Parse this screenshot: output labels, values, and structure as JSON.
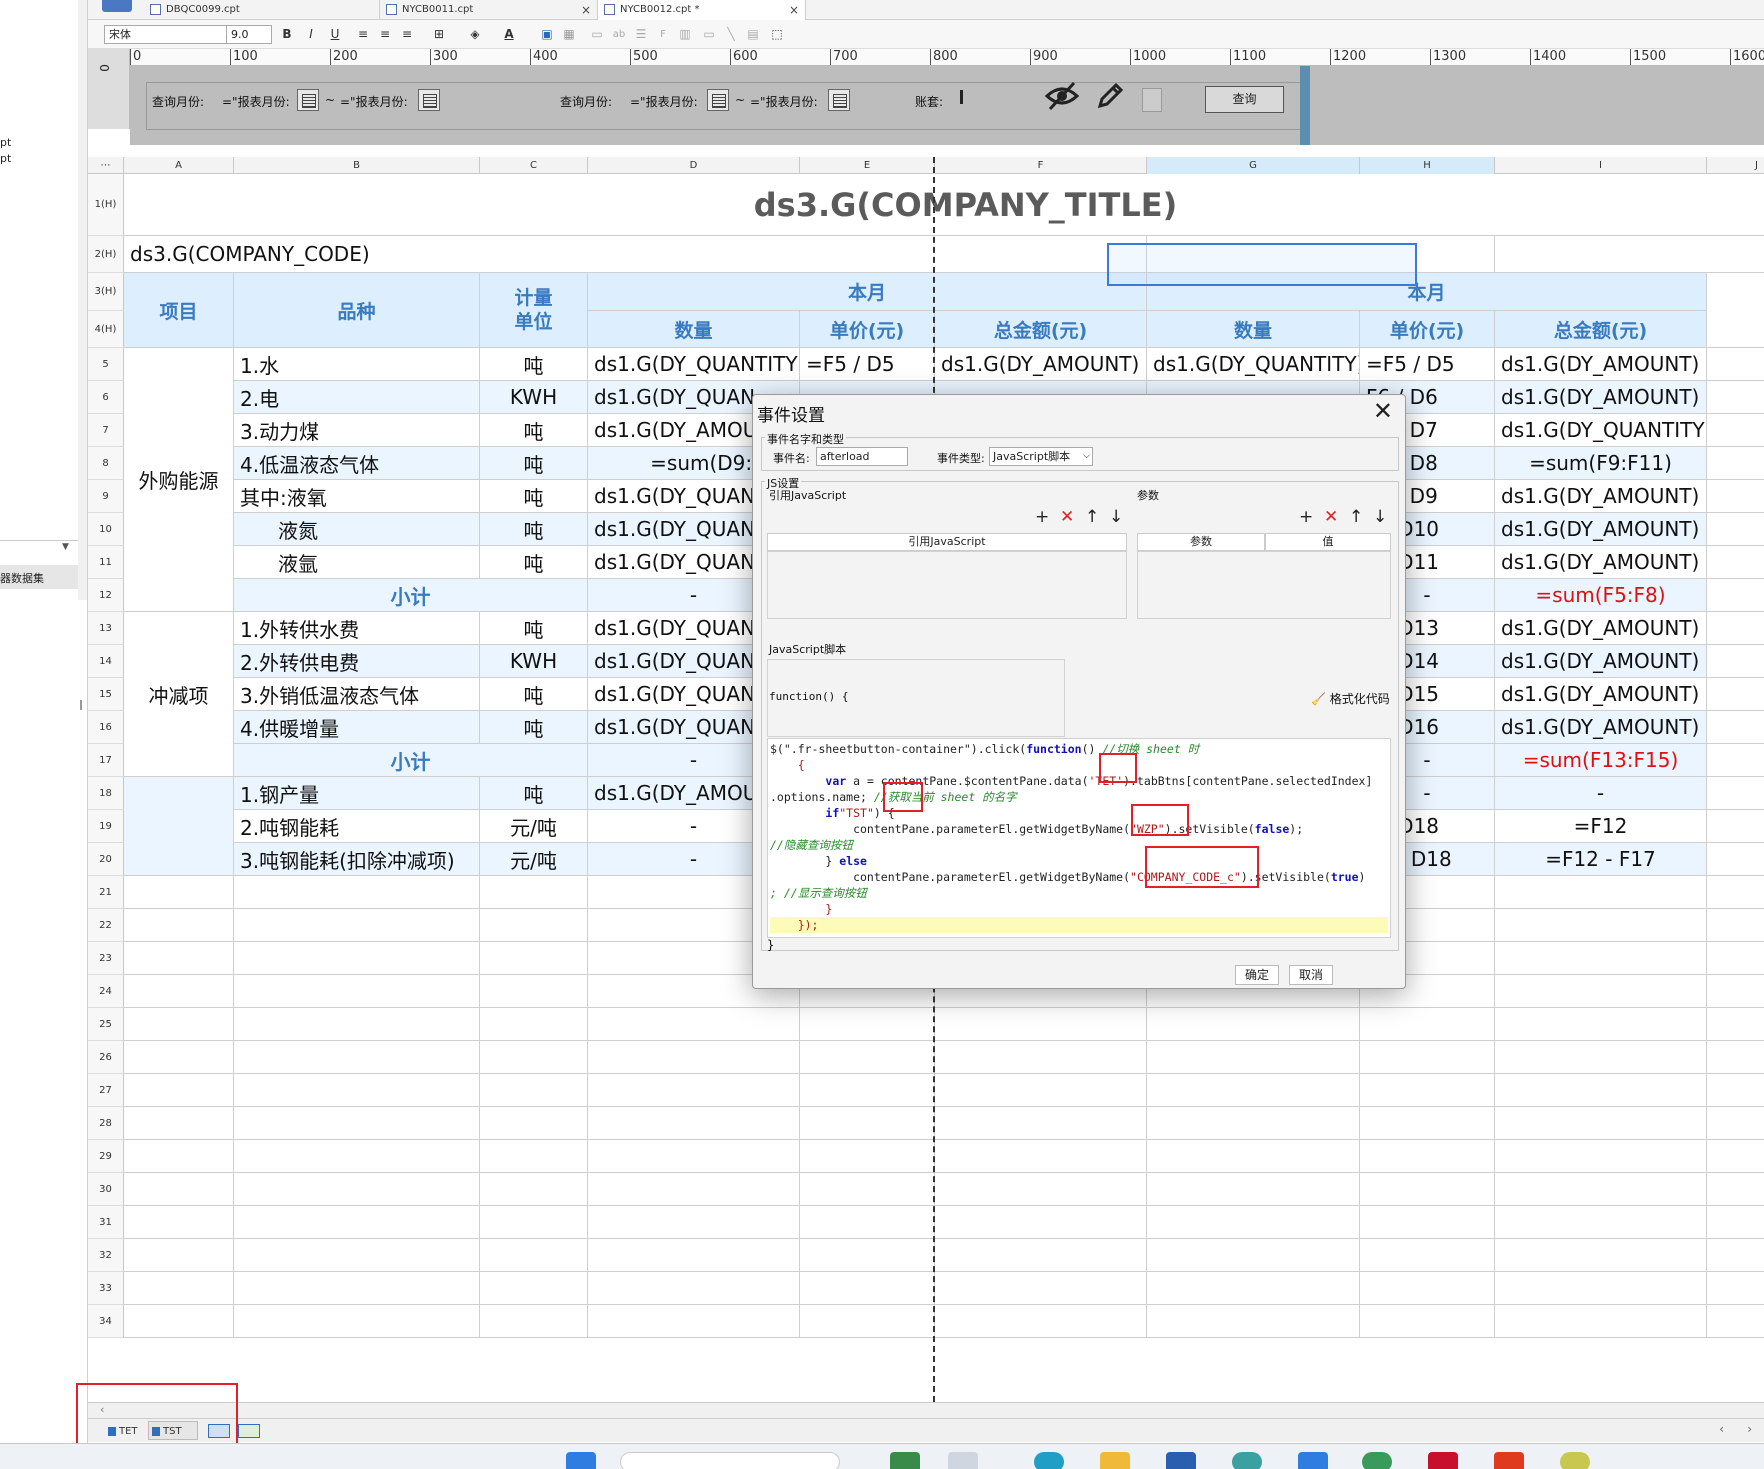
{
  "tabs": [
    {
      "label": "DBQC0099.cpt"
    },
    {
      "label": "NYCB0011.cpt"
    },
    {
      "label": "NYCB0012.cpt *"
    }
  ],
  "toolbar": {
    "font": "宋体",
    "size": "9.0",
    "bold": "B",
    "italic": "I",
    "underline": "U"
  },
  "left_panel": {
    "items": [
      "pt",
      "pt"
    ],
    "dataset_label": "器数据集"
  },
  "ruler": {
    "ticks": [
      "0",
      "100",
      "200",
      "300",
      "400",
      "500",
      "600",
      "700",
      "800",
      "900",
      "1000",
      "1100",
      "1200",
      "1300",
      "1400",
      "1500",
      "1600"
    ],
    "side": "0"
  },
  "params": {
    "label1": "查询月份:",
    "label2": "=\"报表月份:",
    "tilde": "~",
    "label3": "=\"报表月份:",
    "label4": "查询月份:",
    "label5": "=\"报表月份:",
    "tilde2": "~",
    "label6": "=\"报表月份:",
    "label7": "账套:",
    "query_button": "查询"
  },
  "columns": [
    "A",
    "B",
    "C",
    "D",
    "E",
    "F",
    "G",
    "H",
    "I",
    "J"
  ],
  "rows": {
    "labels": [
      "1(H)",
      "2(H)",
      "3(H)",
      "4(H)",
      "5",
      "6",
      "7",
      "8",
      "9",
      "10",
      "11",
      "12",
      "13",
      "14",
      "15",
      "16",
      "17",
      "18",
      "19",
      "20",
      "21",
      "22",
      "23",
      "24",
      "25",
      "26",
      "27",
      "28",
      "29",
      "30",
      "31",
      "32",
      "33",
      "34"
    ]
  },
  "report": {
    "title": "ds3.G(COMPANY_TITLE)",
    "company_code": "ds3.G(COMPANY_CODE)",
    "headers": {
      "item": "项目",
      "variety": "品种",
      "unit": "计量\n单位",
      "month": "本月",
      "month2": "本月",
      "qty": "数量",
      "price": "单价(元)",
      "total": "总金额(元)",
      "qty2": "数量",
      "price2": "单价(元)",
      "total2": "总金额(元)"
    },
    "groups": [
      "外购能源",
      "冲减项"
    ],
    "subtotal": "小计",
    "body": [
      {
        "b": "1.水",
        "c": "吨",
        "d": "ds1.G(DY_QUANTITY)",
        "e": "=F5 / D5",
        "f": "ds1.G(DY_AMOUNT)",
        "g": "ds1.G(DY_QUANTITY)",
        "h": "=F5 / D5",
        "i": "ds1.G(DY_AMOUNT)"
      },
      {
        "b": "2.电",
        "c": "KWH",
        "d": "ds1.G(DY_QUAN",
        "h": "F6 / D6",
        "i": "ds1.G(DY_AMOUNT)"
      },
      {
        "b": "3.动力煤",
        "c": "吨",
        "d": "ds1.G(DY_AMOU",
        "h": "F7 / D7",
        "i": "ds1.G(DY_QUANTITY)"
      },
      {
        "b": "4.低温液态气体",
        "c": "吨",
        "d": "=sum(D9:D11",
        "h": "F8 / D8",
        "i": "=sum(F9:F11)"
      },
      {
        "b": "其中:液氧",
        "c": "吨",
        "d": "ds1.G(DY_QUAN",
        "h": "F9 / D9",
        "i": "ds1.G(DY_AMOUNT)"
      },
      {
        "b": "液氮",
        "c": "吨",
        "d": "ds1.G(DY_QUAN",
        "h": "0 / D10",
        "i": "ds1.G(DY_AMOUNT)"
      },
      {
        "b": "液氩",
        "c": "吨",
        "d": "ds1.G(DY_QUAN",
        "h": "1 / D11",
        "i": "ds1.G(DY_AMOUNT)"
      },
      {
        "b": "",
        "c": "",
        "d": "-",
        "h": "-",
        "i": "=sum(F5:F8)"
      },
      {
        "b": "1.外转供水费",
        "c": "吨",
        "d": "ds1.G(DY_QUAN",
        "h": "3 / D13",
        "i": "ds1.G(DY_AMOUNT)"
      },
      {
        "b": "2.外转供电费",
        "c": "KWH",
        "d": "ds1.G(DY_QUAN",
        "h": "4 / D14",
        "i": "ds1.G(DY_AMOUNT)"
      },
      {
        "b": "3.外销低温液态气体",
        "c": "吨",
        "d": "ds1.G(DY_QUAN",
        "h": "5 / D15",
        "i": "ds1.G(DY_AMOUNT)"
      },
      {
        "b": "4.供暖增量",
        "c": "吨",
        "d": "ds1.G(DY_QUAN",
        "h": "6 / D16",
        "i": "ds1.G(DY_AMOUNT)"
      },
      {
        "b": "",
        "c": "",
        "d": "-",
        "h": "-",
        "i": "=sum(F13:F15)"
      },
      {
        "b": "1.钢产量",
        "c": "吨",
        "d": "ds1.G(DY_AMOU",
        "h": "-",
        "i": "-"
      },
      {
        "b": "2.吨钢能耗",
        "c": "元/吨",
        "d": "-",
        "h": "9 / D18",
        "i": "=F12"
      },
      {
        "b": "3.吨钢能耗(扣除冲减项)",
        "c": "元/吨",
        "d": "-",
        "h": "20 / D18",
        "i": "=F12 - F17"
      }
    ]
  },
  "dialog": {
    "title": "事件设置",
    "group1": "事件名字和类型",
    "event_name_label": "事件名:",
    "event_name_value": "afterload",
    "event_type_label": "事件类型:",
    "event_type_value": "JavaScript脚本",
    "js_group": "JS设置",
    "ref_js": "引用JavaScript",
    "params": "参数",
    "ref_js_col": "引用JavaScript",
    "param_col": "参数",
    "value_col": "值",
    "script_label": "JavaScript脚本",
    "func_header": "function() {",
    "format_code": "格式化代码",
    "closing": "}",
    "ok": "确定",
    "cancel": "取消"
  },
  "code_lines": {
    "l1a": "$(\".fr-sheetbutton-container\").click(",
    "l1b": "function",
    "l1c": "() ",
    "l1d": "//切换 sheet 时",
    "l2": "    {",
    "l3a": "        ",
    "l3b": "var",
    " l3c": "",
    "l3d": " a = contentPane.$contentPane.data(",
    "l3e": "'TET'",
    "l3f": ").tabBtns[contentPane.selectedIndex]",
    "l4a": ".options.name; ",
    "l4b": "//获取当前 sheet 的名字",
    "l5a": "        ",
    "l5b": "if",
    " l5c": " (a == ",
    "l5d": "\"TST\"",
    "l5e": ") {",
    "l6a": "            contentPane.parameterEl.getWidgetByName(",
    "l6b": "\"WZP\"",
    "l6c": ").setVisible(",
    "l6d": "false",
    "l6e": ");",
    "l7": "//隐藏查询按钮",
    "l8a": "        } ",
    "l8b": "else",
    " l8c": " {",
    "l9a": "            contentPane.parameterEl.getWidgetByName(",
    "l9b": "\"COMPANY_CODE_c\"",
    "l9c": ").setVisible(",
    "l9d": "true",
    "l9e": ")",
    "l10": "; //显示查询按钮",
    "l11": "        }",
    "l12": "    });"
  },
  "sheet_tabs": [
    "TET",
    "TST"
  ]
}
